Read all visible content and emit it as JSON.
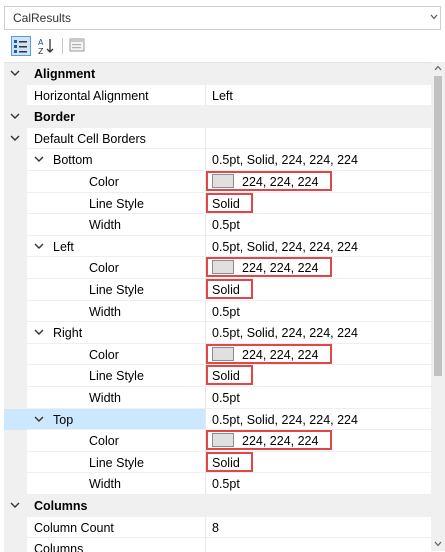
{
  "object_selector": {
    "value": "CalResults",
    "dropdown_icon": "chevron-down-icon"
  },
  "toolbar": {
    "categorized_icon": "categorized-icon",
    "alphabetical_icon": "sort-az-icon",
    "property_pages_icon": "property-pages-icon"
  },
  "rows": [
    {
      "label": "Alignment"
    },
    {
      "label": "Horizontal Alignment",
      "value": "Left"
    },
    {
      "label": "Border"
    },
    {
      "label": "Default Cell Borders"
    },
    {
      "label": "Bottom",
      "value": "0.5pt, Solid, 224, 224, 224"
    },
    {
      "label": "Color",
      "value": "224, 224, 224"
    },
    {
      "label": "Line Style",
      "value": "Solid"
    },
    {
      "label": "Width",
      "value": "0.5pt"
    },
    {
      "label": "Left",
      "value": "0.5pt, Solid, 224, 224, 224"
    },
    {
      "label": "Color",
      "value": "224, 224, 224"
    },
    {
      "label": "Line Style",
      "value": "Solid"
    },
    {
      "label": "Width",
      "value": "0.5pt"
    },
    {
      "label": "Right",
      "value": "0.5pt, Solid, 224, 224, 224"
    },
    {
      "label": "Color",
      "value": "224, 224, 224"
    },
    {
      "label": "Line Style",
      "value": "Solid"
    },
    {
      "label": "Width",
      "value": "0.5pt"
    },
    {
      "label": "Top",
      "value": "0.5pt, Solid, 224, 224, 224"
    },
    {
      "label": "Color",
      "value": "224, 224, 224"
    },
    {
      "label": "Line Style",
      "value": "Solid"
    },
    {
      "label": "Width",
      "value": "0.5pt"
    },
    {
      "label": "Columns"
    },
    {
      "label": "Column Count",
      "value": "8"
    },
    {
      "label": "Columns"
    }
  ],
  "colors": {
    "swatch": "#e0e0e0",
    "highlight_box": "#e04848",
    "selected_row": "#cce8ff",
    "category_background": "#f0f0f0"
  }
}
